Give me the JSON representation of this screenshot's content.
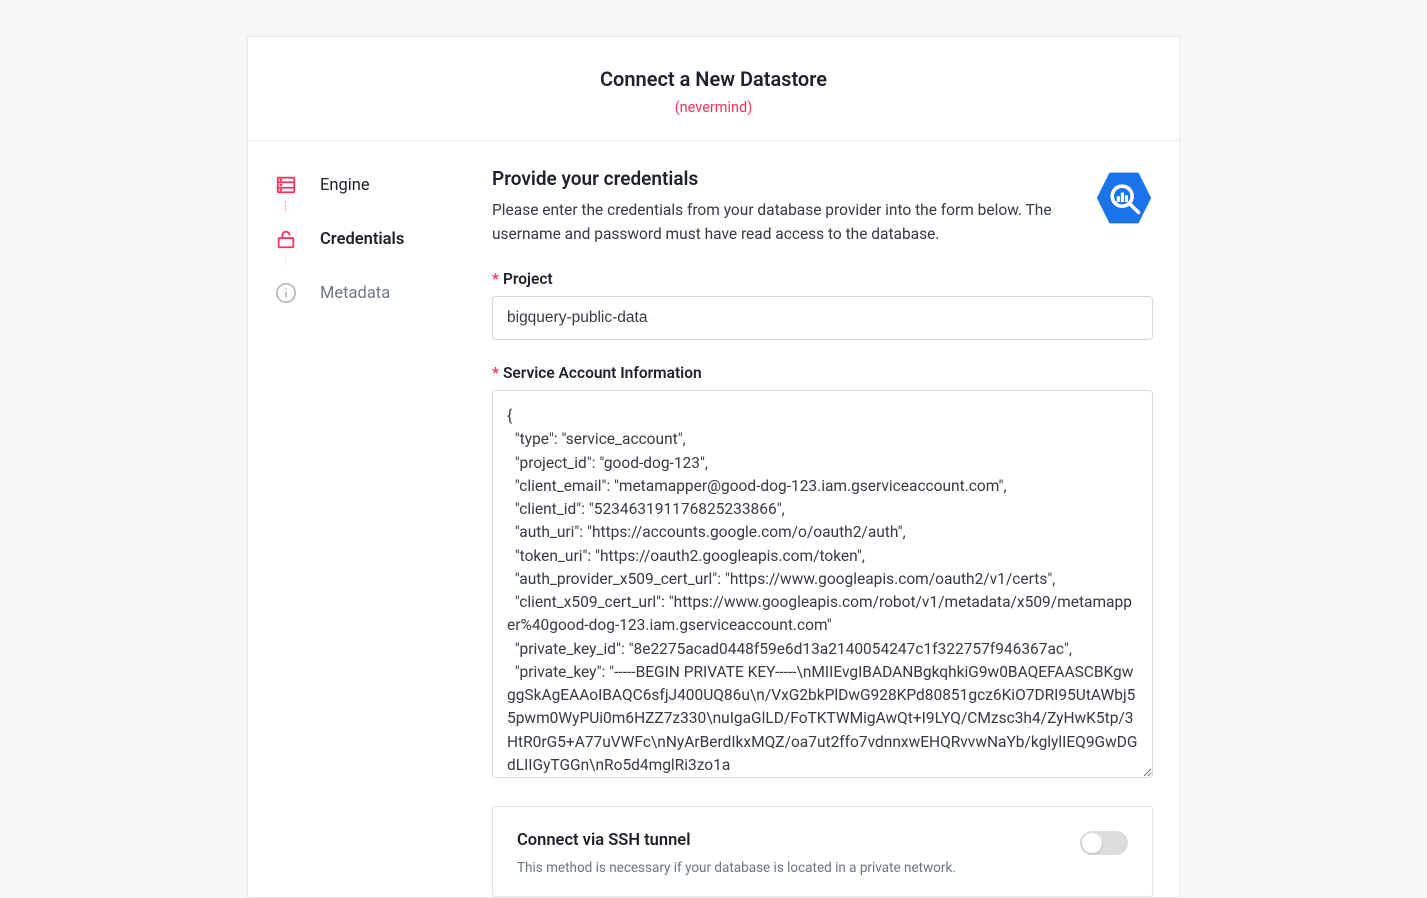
{
  "header": {
    "title": "Connect a New Datastore",
    "cancel": "(nevermind)"
  },
  "steps": {
    "items": [
      {
        "label": "Engine"
      },
      {
        "label": "Credentials"
      },
      {
        "label": "Metadata"
      }
    ]
  },
  "form": {
    "title": "Provide your credentials",
    "description": "Please enter the credentials from your database provider into the form below. The username and password must have read access to the database.",
    "project": {
      "label": "Project",
      "value": "bigquery-public-data"
    },
    "service_account": {
      "label": "Service Account Information",
      "value": "{\n  \"type\": \"service_account\",\n  \"project_id\": \"good-dog-123\",\n  \"client_email\": \"metamapper@good-dog-123.iam.gserviceaccount.com\",\n  \"client_id\": \"523463191176825233866\",\n  \"auth_uri\": \"https://accounts.google.com/o/oauth2/auth\",\n  \"token_uri\": \"https://oauth2.googleapis.com/token\",\n  \"auth_provider_x509_cert_url\": \"https://www.googleapis.com/oauth2/v1/certs\",\n  \"client_x509_cert_url\": \"https://www.googleapis.com/robot/v1/metadata/x509/metamapper%40good-dog-123.iam.gserviceaccount.com\"\n  \"private_key_id\": \"8e2275acad0448f59e6d13a2140054247c1f322757f946367ac\",\n  \"private_key\": \"-----BEGIN PRIVATE KEY-----\\nMIIEvgIBADANBgkqhkiG9w0BAQEFAASCBKgwggSkAgEAAoIBAQC6sfjJ400UQ86u\\n/VxG2bkPlDwG928KPd80851gcz6KiO7DRI95UtAWbj55pwm0WyPUi0m6HZZ7z330\\nuIgaGlLD/FoTKTWMigAwQt+I9LYQ/CMzsc3h4/ZyHwK5tp/3HtR0rG5+A77uVWFc\\nNyArBerdIkxMQZ/oa7ut2ffo7vdnnxwEHQRvvwNaYb/kglylIEQ9GwDGdLIIGyTGGn\\nRo5d4mglRi3zo1a"
    },
    "ssh": {
      "title": "Connect via SSH tunnel",
      "description": "This method is necessary if your database is located in a private network."
    }
  },
  "colors": {
    "accent": "#f5365c",
    "bigquery_blue": "#1a73e8"
  }
}
